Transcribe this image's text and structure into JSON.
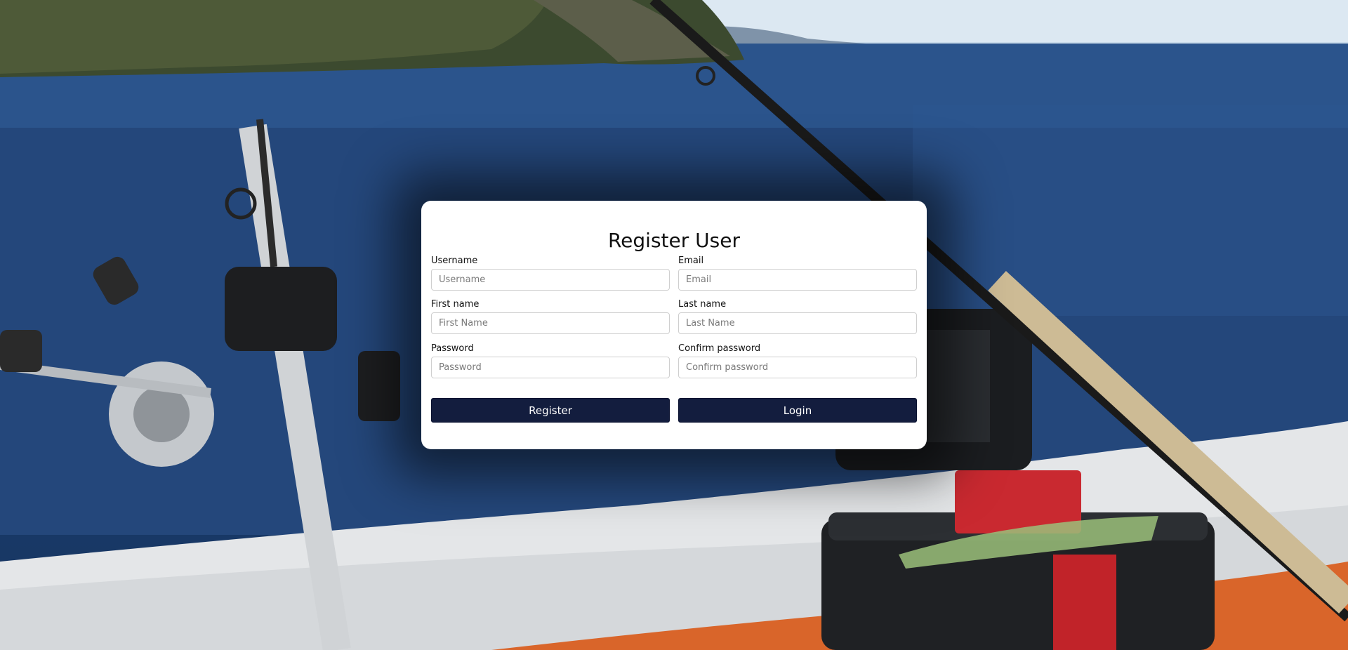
{
  "page": {
    "title": "Register User"
  },
  "form": {
    "username": {
      "label": "Username",
      "placeholder": "Username",
      "value": ""
    },
    "email": {
      "label": "Email",
      "placeholder": "Email",
      "value": ""
    },
    "first_name": {
      "label": "First name",
      "placeholder": "First Name",
      "value": ""
    },
    "last_name": {
      "label": "Last name",
      "placeholder": "Last Name",
      "value": ""
    },
    "password": {
      "label": "Password",
      "placeholder": "Password",
      "value": ""
    },
    "confirm_password": {
      "label": "Confirm password",
      "placeholder": "Confirm password",
      "value": ""
    }
  },
  "actions": {
    "register_label": "Register",
    "login_label": "Login"
  },
  "theme": {
    "button_color": "#131d3e",
    "card_background": "#ffffff"
  }
}
